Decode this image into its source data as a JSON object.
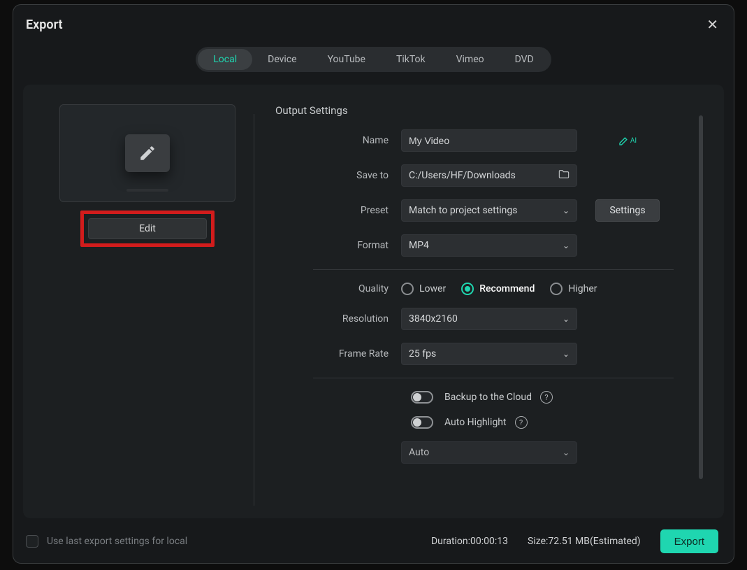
{
  "dialog": {
    "title": "Export"
  },
  "tabs": [
    "Local",
    "Device",
    "YouTube",
    "TikTok",
    "Vimeo",
    "DVD"
  ],
  "active_tab_index": 0,
  "edit_button": "Edit",
  "section_title": "Output Settings",
  "labels": {
    "name": "Name",
    "save_to": "Save to",
    "preset": "Preset",
    "format": "Format",
    "quality": "Quality",
    "resolution": "Resolution",
    "frame_rate": "Frame Rate"
  },
  "values": {
    "name": "My Video",
    "save_to": "C:/Users/HF/Downloads",
    "preset": "Match to project settings",
    "format": "MP4",
    "resolution": "3840x2160",
    "frame_rate": "25 fps",
    "auto_select": "Auto"
  },
  "settings_button": "Settings",
  "quality_options": {
    "lower": "Lower",
    "recommend": "Recommend",
    "higher": "Higher"
  },
  "quality_selected": "recommend",
  "toggles": {
    "backup": "Backup to the Cloud",
    "highlight": "Auto Highlight"
  },
  "footer": {
    "use_last": "Use last export settings for local",
    "duration_label": "Duration:",
    "duration_value": "00:00:13",
    "size_label": "Size:",
    "size_value": "72.51 MB",
    "size_suffix": "(Estimated)",
    "export": "Export"
  },
  "icons": {
    "close": "✕",
    "chevron": "⌄",
    "ai_suffix": "AI",
    "question": "?"
  }
}
